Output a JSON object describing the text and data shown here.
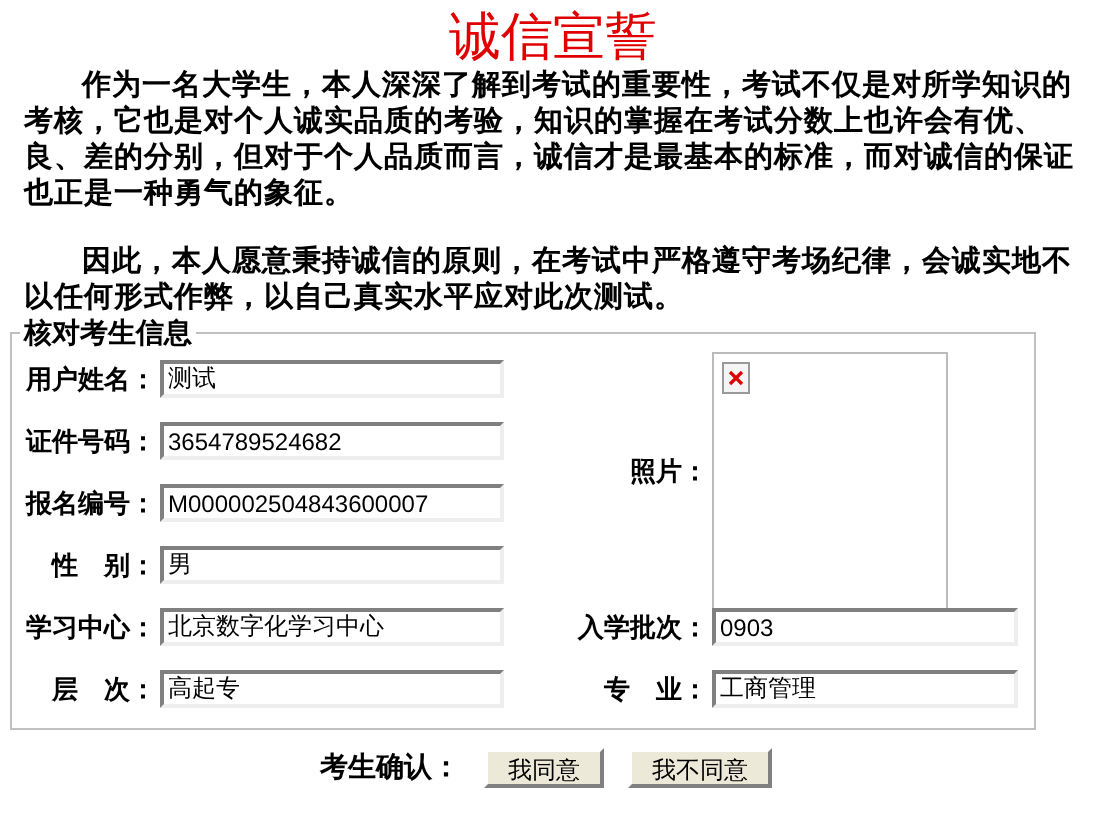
{
  "title": "诚信宣誓",
  "paragraphs": [
    "作为一名大学生，本人深深了解到考试的重要性，考试不仅是对所学知识的考核，它也是对个人诚实品质的考验，知识的掌握在考试分数上也许会有优、良、差的分别，但对于个人品质而言，诚信才是最基本的标准，而对诚信的保证也正是一种勇气的象征。",
    "因此，本人愿意秉持诚信的原则，在考试中严格遵守考场纪律，会诚实地不以任何形式作弊，以自己真实水平应对此次测试。"
  ],
  "section": {
    "legend": "核对考生信息",
    "left_fields": [
      {
        "label": "用户姓名：",
        "value": "测试"
      },
      {
        "label": "证件号码：",
        "value": "3654789524682"
      },
      {
        "label": "报名编号：",
        "value": "M000002504843600007"
      },
      {
        "label": "性　别：",
        "value": "男"
      },
      {
        "label": "学习中心：",
        "value": "北京数字化学习中心"
      },
      {
        "label": "层　次：",
        "value": "高起专"
      }
    ],
    "photo": {
      "label": "照片："
    },
    "right_fields": [
      {
        "label": "入学批次：",
        "value": "0903"
      },
      {
        "label": "专　业：",
        "value": "工商管理"
      }
    ]
  },
  "confirm": {
    "label": "考生确认：",
    "buttons": [
      "我同意",
      "我不同意"
    ]
  }
}
